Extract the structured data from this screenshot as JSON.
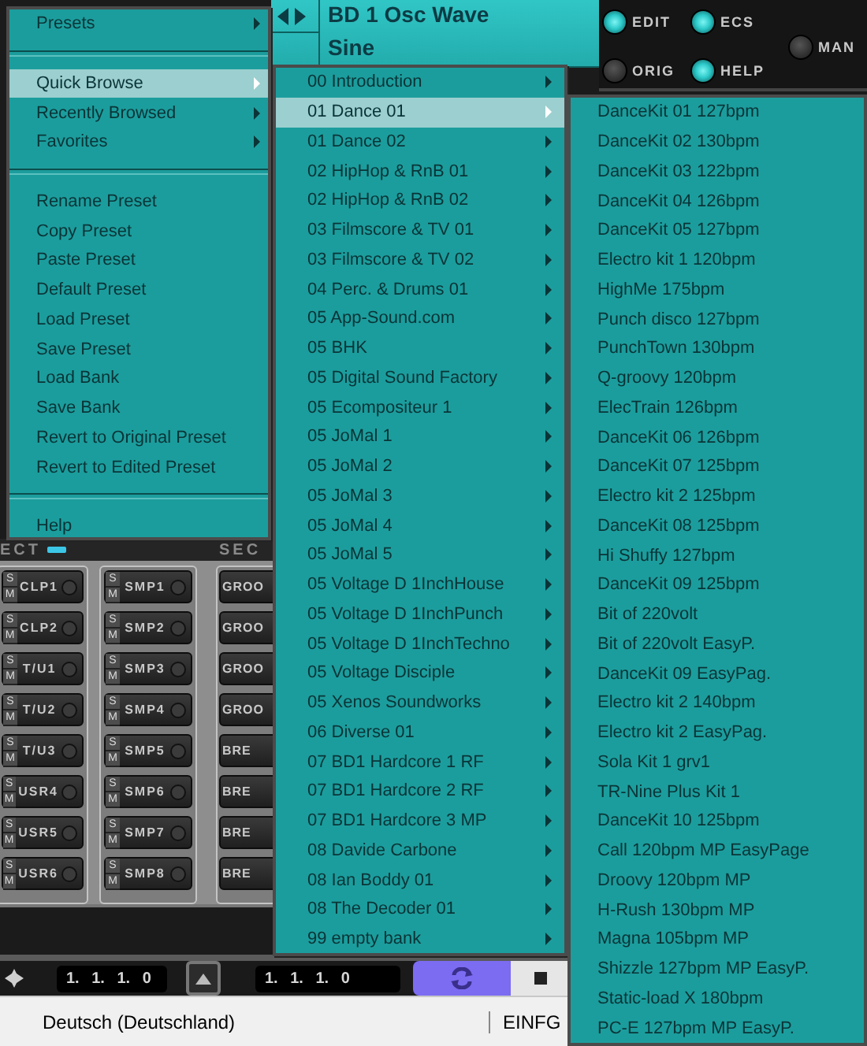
{
  "display": {
    "patch": "BD 1 Osc Wave",
    "wave": "Sine"
  },
  "mode_buttons": {
    "grid": [
      [
        {
          "label": "EDIT",
          "on": true
        },
        {
          "label": "ECS",
          "on": true
        }
      ],
      [
        {
          "label": "ORIG",
          "on": false
        },
        {
          "label": "HELP",
          "on": true
        }
      ]
    ],
    "side": [
      {
        "label": "MAN",
        "on": false
      }
    ]
  },
  "pad_section": {
    "headers": [
      "ECT",
      "SEC"
    ],
    "columns": [
      {
        "pads": [
          {
            "label": "CLP1",
            "solo": "S",
            "mute": "M"
          },
          {
            "label": "CLP2",
            "solo": "S",
            "mute": "M"
          },
          {
            "label": "T/U1",
            "solo": "S",
            "mute": "M"
          },
          {
            "label": "T/U2",
            "solo": "S",
            "mute": "M"
          },
          {
            "label": "T/U3",
            "solo": "S",
            "mute": "M"
          },
          {
            "label": "USR4",
            "solo": "S",
            "mute": "M"
          },
          {
            "label": "USR5",
            "solo": "S",
            "mute": "M"
          },
          {
            "label": "USR6",
            "solo": "S",
            "mute": "M"
          }
        ]
      },
      {
        "pads": [
          {
            "label": "SMP1",
            "solo": "S",
            "mute": "M"
          },
          {
            "label": "SMP2",
            "solo": "S",
            "mute": "M"
          },
          {
            "label": "SMP3",
            "solo": "S",
            "mute": "M"
          },
          {
            "label": "SMP4",
            "solo": "S",
            "mute": "M"
          },
          {
            "label": "SMP5",
            "solo": "S",
            "mute": "M"
          },
          {
            "label": "SMP6",
            "solo": "S",
            "mute": "M"
          },
          {
            "label": "SMP7",
            "solo": "S",
            "mute": "M"
          },
          {
            "label": "SMP8",
            "solo": "S",
            "mute": "M"
          }
        ]
      },
      {
        "pads": [
          {
            "label": "GROO"
          },
          {
            "label": "GROO"
          },
          {
            "label": "GROO"
          },
          {
            "label": "GROO"
          },
          {
            "label": "BRE"
          },
          {
            "label": "BRE"
          },
          {
            "label": "BRE"
          },
          {
            "label": "BRE"
          }
        ]
      }
    ]
  },
  "transport": {
    "positions": [
      "1. 1. 1. 0",
      "1. 1. 1. 0"
    ],
    "loop_on": true
  },
  "status_bar": {
    "language": "Deutsch (Deutschland)",
    "mode": "EINFG"
  },
  "menus": [
    {
      "items": [
        {
          "kind": "item",
          "label": "Presets",
          "submenu": true,
          "selected": false
        },
        {
          "kind": "separator"
        },
        {
          "kind": "item",
          "label": "Quick Browse",
          "submenu": true,
          "selected": true
        },
        {
          "kind": "item",
          "label": "Recently Browsed",
          "submenu": true,
          "selected": false
        },
        {
          "kind": "item",
          "label": "Favorites",
          "submenu": true,
          "selected": false
        },
        {
          "kind": "separator"
        },
        {
          "kind": "item",
          "label": "Rename Preset",
          "submenu": false,
          "selected": false
        },
        {
          "kind": "item",
          "label": "Copy Preset",
          "submenu": false,
          "selected": false
        },
        {
          "kind": "item",
          "label": "Paste Preset",
          "submenu": false,
          "selected": false
        },
        {
          "kind": "item",
          "label": "Default Preset",
          "submenu": false,
          "selected": false
        },
        {
          "kind": "item",
          "label": "Load Preset",
          "submenu": false,
          "selected": false
        },
        {
          "kind": "item",
          "label": "Save Preset",
          "submenu": false,
          "selected": false
        },
        {
          "kind": "item",
          "label": "Load Bank",
          "submenu": false,
          "selected": false
        },
        {
          "kind": "item",
          "label": "Save Bank",
          "submenu": false,
          "selected": false
        },
        {
          "kind": "item",
          "label": "Revert to Original Preset",
          "submenu": false,
          "selected": false
        },
        {
          "kind": "item",
          "label": "Revert to Edited Preset",
          "submenu": false,
          "selected": false
        },
        {
          "kind": "separator"
        },
        {
          "kind": "item",
          "label": "Help",
          "submenu": false,
          "selected": false
        }
      ]
    },
    {
      "items": [
        {
          "kind": "item",
          "label": "00 Introduction",
          "submenu": true,
          "selected": false
        },
        {
          "kind": "item",
          "label": "01 Dance 01",
          "submenu": true,
          "selected": true
        },
        {
          "kind": "item",
          "label": "01 Dance 02",
          "submenu": true,
          "selected": false
        },
        {
          "kind": "item",
          "label": "02 HipHop & RnB 01",
          "submenu": true,
          "selected": false
        },
        {
          "kind": "item",
          "label": "02 HipHop & RnB 02",
          "submenu": true,
          "selected": false
        },
        {
          "kind": "item",
          "label": "03 Filmscore & TV 01",
          "submenu": true,
          "selected": false
        },
        {
          "kind": "item",
          "label": "03 Filmscore & TV 02",
          "submenu": true,
          "selected": false
        },
        {
          "kind": "item",
          "label": "04 Perc. & Drums 01",
          "submenu": true,
          "selected": false
        },
        {
          "kind": "item",
          "label": "05 App-Sound.com",
          "submenu": true,
          "selected": false
        },
        {
          "kind": "item",
          "label": "05 BHK",
          "submenu": true,
          "selected": false
        },
        {
          "kind": "item",
          "label": "05 Digital Sound Factory",
          "submenu": true,
          "selected": false
        },
        {
          "kind": "item",
          "label": "05 Ecompositeur 1",
          "submenu": true,
          "selected": false
        },
        {
          "kind": "item",
          "label": "05 JoMal 1",
          "submenu": true,
          "selected": false
        },
        {
          "kind": "item",
          "label": "05 JoMal 2",
          "submenu": true,
          "selected": false
        },
        {
          "kind": "item",
          "label": "05 JoMal 3",
          "submenu": true,
          "selected": false
        },
        {
          "kind": "item",
          "label": "05 JoMal 4",
          "submenu": true,
          "selected": false
        },
        {
          "kind": "item",
          "label": "05 JoMal 5",
          "submenu": true,
          "selected": false
        },
        {
          "kind": "item",
          "label": "05 Voltage D 1InchHouse",
          "submenu": true,
          "selected": false
        },
        {
          "kind": "item",
          "label": "05 Voltage D 1InchPunch",
          "submenu": true,
          "selected": false
        },
        {
          "kind": "item",
          "label": "05 Voltage D 1InchTechno",
          "submenu": true,
          "selected": false
        },
        {
          "kind": "item",
          "label": "05 Voltage Disciple",
          "submenu": true,
          "selected": false
        },
        {
          "kind": "item",
          "label": "05 Xenos Soundworks",
          "submenu": true,
          "selected": false
        },
        {
          "kind": "item",
          "label": "06 Diverse 01",
          "submenu": true,
          "selected": false
        },
        {
          "kind": "item",
          "label": "07 BD1 Hardcore 1 RF",
          "submenu": true,
          "selected": false
        },
        {
          "kind": "item",
          "label": "07 BD1 Hardcore 2 RF",
          "submenu": true,
          "selected": false
        },
        {
          "kind": "item",
          "label": "07 BD1 Hardcore 3 MP",
          "submenu": true,
          "selected": false
        },
        {
          "kind": "item",
          "label": "08 Davide Carbone",
          "submenu": true,
          "selected": false
        },
        {
          "kind": "item",
          "label": "08 Ian Boddy 01",
          "submenu": true,
          "selected": false
        },
        {
          "kind": "item",
          "label": "08 The Decoder 01",
          "submenu": true,
          "selected": false
        },
        {
          "kind": "item",
          "label": "99 empty bank",
          "submenu": true,
          "selected": false
        }
      ]
    },
    {
      "items": [
        {
          "kind": "item",
          "label": "DanceKit 01 127bpm",
          "selected": false
        },
        {
          "kind": "item",
          "label": "DanceKit 02 130bpm",
          "selected": false
        },
        {
          "kind": "item",
          "label": "DanceKit 03 122bpm",
          "selected": false
        },
        {
          "kind": "item",
          "label": "DanceKit 04 126bpm",
          "selected": false
        },
        {
          "kind": "item",
          "label": "DanceKit 05 127bpm",
          "selected": false
        },
        {
          "kind": "item",
          "label": "Electro kit 1 120bpm",
          "selected": false
        },
        {
          "kind": "item",
          "label": "HighMe 175bpm",
          "selected": false
        },
        {
          "kind": "item",
          "label": "Punch disco 127bpm",
          "selected": false
        },
        {
          "kind": "item",
          "label": "PunchTown 130bpm",
          "selected": false
        },
        {
          "kind": "item",
          "label": "Q-groovy 120bpm",
          "selected": false
        },
        {
          "kind": "item",
          "label": "ElecTrain 126bpm",
          "selected": false
        },
        {
          "kind": "item",
          "label": "DanceKit 06 126bpm",
          "selected": false
        },
        {
          "kind": "item",
          "label": "DanceKit 07 125bpm",
          "selected": false
        },
        {
          "kind": "item",
          "label": "Electro kit 2 125bpm",
          "selected": false
        },
        {
          "kind": "item",
          "label": "DanceKit 08 125bpm",
          "selected": false
        },
        {
          "kind": "item",
          "label": "Hi Shuffy 127bpm",
          "selected": false
        },
        {
          "kind": "item",
          "label": "DanceKit 09 125bpm",
          "selected": false
        },
        {
          "kind": "item",
          "label": "Bit of 220volt",
          "selected": false
        },
        {
          "kind": "item",
          "label": "Bit of 220volt EasyP.",
          "selected": false
        },
        {
          "kind": "item",
          "label": "DanceKit 09 EasyPag.",
          "selected": false
        },
        {
          "kind": "item",
          "label": "Electro kit 2 140bpm",
          "selected": false
        },
        {
          "kind": "item",
          "label": "Electro kit 2 EasyPag.",
          "selected": false
        },
        {
          "kind": "item",
          "label": "Sola Kit 1 grv1",
          "selected": false
        },
        {
          "kind": "item",
          "label": "TR-Nine Plus Kit 1",
          "selected": false
        },
        {
          "kind": "item",
          "label": "DanceKit 10 125bpm",
          "selected": false
        },
        {
          "kind": "item",
          "label": "Call 120bpm MP EasyPage",
          "selected": false
        },
        {
          "kind": "item",
          "label": "Droovy 120bpm MP",
          "selected": false
        },
        {
          "kind": "item",
          "label": "H-Rush 130bpm MP",
          "selected": false
        },
        {
          "kind": "item",
          "label": "Magna 105bpm MP",
          "selected": false
        },
        {
          "kind": "item",
          "label": "Shizzle 127bpm MP EasyP.",
          "selected": false
        },
        {
          "kind": "item",
          "label": "Static-load X 180bpm",
          "selected": false
        },
        {
          "kind": "item",
          "label": "PC-E 127bpm MP EasyP.",
          "selected": false
        }
      ]
    }
  ]
}
